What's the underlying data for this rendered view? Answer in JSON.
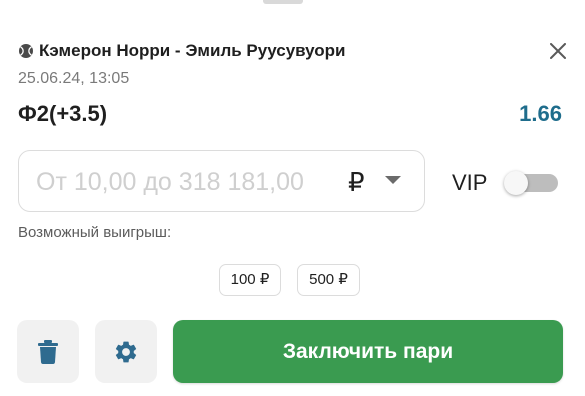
{
  "header": {
    "match_title": "Кэмерон Норри - Эмиль Руусувуори",
    "match_datetime": "25.06.24,  13:05",
    "icons": {
      "sport": "tennis-ball-icon",
      "close": "close-icon"
    }
  },
  "bet": {
    "outcome": "Ф2(+3.5)",
    "odds": "1.66"
  },
  "stake": {
    "placeholder": "От 10,00 до 318 181,00",
    "value": "",
    "currency": "₽",
    "dropdown_icon": "chevron-down-icon"
  },
  "vip": {
    "label": "VIP",
    "enabled": false
  },
  "payout": {
    "label": "Возможный выигрыш:"
  },
  "quick_amounts": [
    "100 ₽",
    "500 ₽"
  ],
  "actions": {
    "delete_icon": "trash-icon",
    "settings_icon": "gear-icon",
    "place_bet_label": "Заключить пари"
  },
  "colors": {
    "odds": "#1f6d8c",
    "primary_button": "#3a9b50",
    "action_icon": "#2f6b8f"
  }
}
